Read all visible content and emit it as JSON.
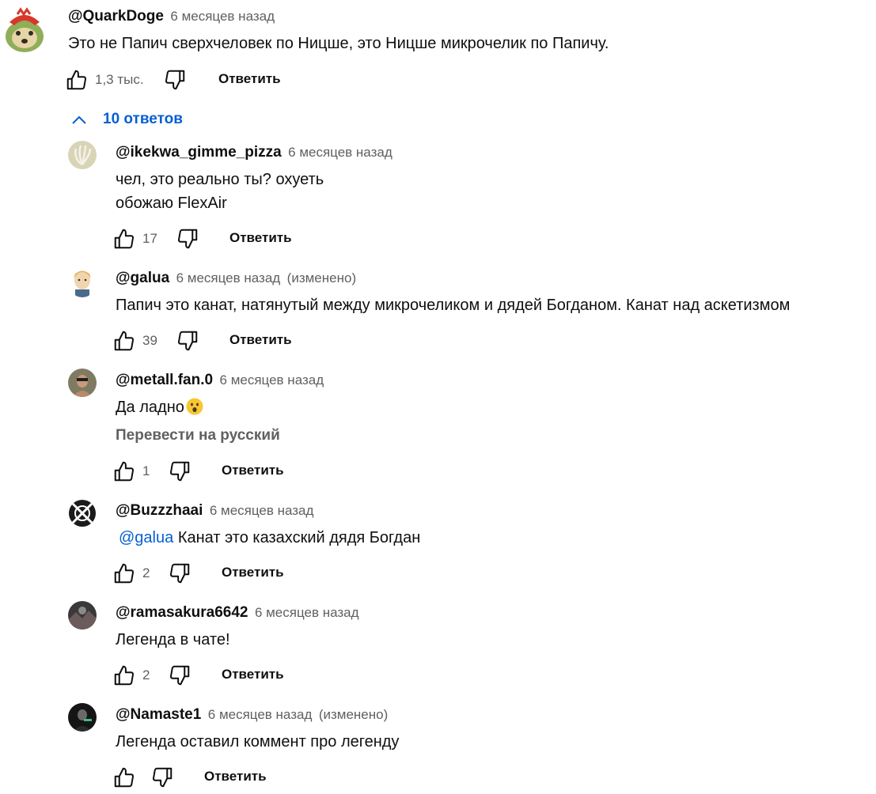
{
  "main_comment": {
    "author": "@QuarkDoge",
    "time": "6 месяцев назад",
    "text": "Это не Папич сверхчеловек по Ницше, это Ницше микрочелик по Папичу.",
    "likes": "1,3 тыс.",
    "reply_label": "Ответить",
    "avatar_icon": "doge-avatar"
  },
  "replies_toggle": {
    "label": "10 ответов",
    "icon": "chevron-up-icon"
  },
  "replies": [
    {
      "author": "@ikekwa_gimme_pizza",
      "time": "6 месяцев назад",
      "edited": "",
      "lines": [
        "чел, это реально ты? охуеть",
        "обожаю FlexAir"
      ],
      "likes": "17",
      "reply_label": "Ответить"
    },
    {
      "author": "@galua",
      "time": "6 месяцев назад",
      "edited": "(изменено)",
      "lines": [
        "Папич это канат, натянутый между микрочеликом и дядей Богданом. Канат над аскетизмом"
      ],
      "likes": "39",
      "reply_label": "Ответить"
    },
    {
      "author": "@metall.fan.0",
      "time": "6 месяцев назад",
      "edited": "",
      "lines": [
        "Да ладно"
      ],
      "emoji": "astonished-face-emoji",
      "translate": "Перевести на русский",
      "likes": "1",
      "reply_label": "Ответить"
    },
    {
      "author": "@Buzzzhaai",
      "time": "6 месяцев назад",
      "edited": "",
      "mention": "@galua",
      "lines": [
        "Канат это казахский дядя Богдан"
      ],
      "likes": "2",
      "reply_label": "Ответить"
    },
    {
      "author": "@ramasakura6642",
      "time": "6 месяцев назад",
      "edited": "",
      "lines": [
        "Легенда в чате!"
      ],
      "likes": "2",
      "reply_label": "Ответить"
    },
    {
      "author": "@Namaste1",
      "time": "6 месяцев назад",
      "edited": "(изменено)",
      "lines": [
        "Легенда оставил коммент про легенду"
      ],
      "likes": "",
      "reply_label": "Ответить"
    }
  ],
  "colors": {
    "link": "#065fd4",
    "secondary": "#606060",
    "text": "#0f0f0f"
  }
}
